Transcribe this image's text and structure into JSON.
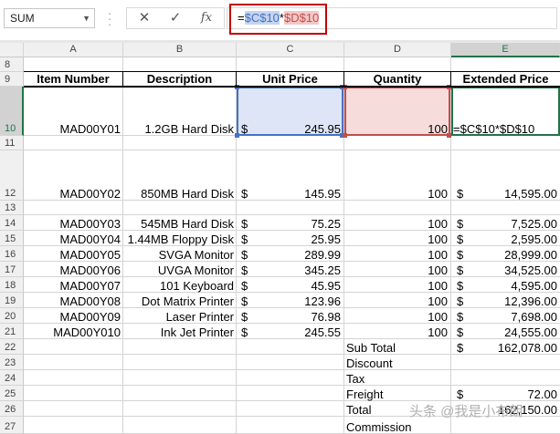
{
  "formula_bar": {
    "name_box": "SUM",
    "cancel_symbol": "✕",
    "enter_symbol": "✓",
    "function_symbol": "fx",
    "formula_prefix": "=",
    "ref1": "$C$10",
    "operator": "*",
    "ref2": "$D$10"
  },
  "columns": [
    "A",
    "B",
    "C",
    "D",
    "E"
  ],
  "rows": [
    "8",
    "9",
    "10",
    "11",
    "12",
    "13",
    "14",
    "15",
    "16",
    "17",
    "18",
    "19",
    "20",
    "21",
    "22",
    "23",
    "24",
    "25",
    "26",
    "27"
  ],
  "headers": {
    "item_number": "Item Number",
    "description": "Description",
    "unit_price": "Unit Price",
    "quantity": "Quantity",
    "extended_price": "Extended Price"
  },
  "currency": "$",
  "items": [
    {
      "row": "10",
      "item": "MAD00Y01",
      "desc": "1.2GB Hard Disk",
      "price": "245.95",
      "qty": "100",
      "ext": "=$C$10*$D$10"
    },
    {
      "row": "12",
      "item": "MAD00Y02",
      "desc": "850MB Hard Disk",
      "price": "145.95",
      "qty": "100",
      "ext": "14,595.00"
    },
    {
      "row": "14",
      "item": "MAD00Y03",
      "desc": "545MB Hard Disk",
      "price": "75.25",
      "qty": "100",
      "ext": "7,525.00"
    },
    {
      "row": "15",
      "item": "MAD00Y04",
      "desc": "1.44MB Floppy Disk",
      "price": "25.95",
      "qty": "100",
      "ext": "2,595.00"
    },
    {
      "row": "16",
      "item": "MAD00Y05",
      "desc": "SVGA Monitor",
      "price": "289.99",
      "qty": "100",
      "ext": "28,999.00"
    },
    {
      "row": "17",
      "item": "MAD00Y06",
      "desc": "UVGA Monitor",
      "price": "345.25",
      "qty": "100",
      "ext": "34,525.00"
    },
    {
      "row": "18",
      "item": "MAD00Y07",
      "desc": "101 Keyboard",
      "price": "45.95",
      "qty": "100",
      "ext": "4,595.00"
    },
    {
      "row": "19",
      "item": "MAD00Y08",
      "desc": "Dot Matrix Printer",
      "price": "123.96",
      "qty": "100",
      "ext": "12,396.00"
    },
    {
      "row": "20",
      "item": "MAD00Y09",
      "desc": "Laser Printer",
      "price": "76.98",
      "qty": "100",
      "ext": "7,698.00"
    },
    {
      "row": "21",
      "item": "MAD00Y010",
      "desc": "Ink Jet Printer",
      "price": "245.55",
      "qty": "100",
      "ext": "24,555.00"
    }
  ],
  "summary": [
    {
      "row": "22",
      "label": "Sub Total",
      "value": "162,078.00",
      "show_currency": true
    },
    {
      "row": "23",
      "label": "Discount",
      "value": "",
      "show_currency": false
    },
    {
      "row": "24",
      "label": "Tax",
      "value": "",
      "show_currency": false
    },
    {
      "row": "25",
      "label": "Freight",
      "value": "72.00",
      "show_currency": true
    },
    {
      "row": "26",
      "label": "Total",
      "value": "162,150.00",
      "show_currency": false
    },
    {
      "row": "27",
      "label": "Commission",
      "value": "",
      "show_currency": false
    }
  ],
  "watermark": "头条 @我是小布朗",
  "colors": {
    "ref1": "#4472c4",
    "ref2": "#c0504d",
    "active": "#217346",
    "highlight": "#c00000"
  }
}
